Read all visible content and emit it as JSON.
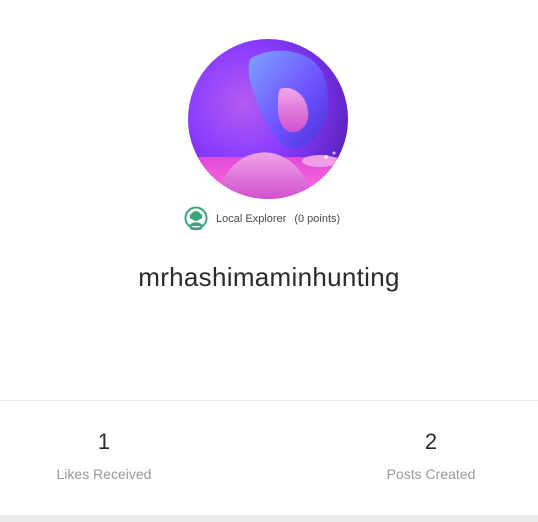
{
  "profile": {
    "username": "mrhashimaminhunting",
    "badge": {
      "icon": "explorer-badge-icon",
      "title": "Local Explorer",
      "points": "(0 points)"
    }
  },
  "stats": {
    "likes": {
      "value": "1",
      "label": "Likes Received"
    },
    "posts": {
      "value": "2",
      "label": "Posts Created"
    }
  },
  "colors": {
    "badge_green": "#3aa57a",
    "avatar_purple": "#8a3cff",
    "avatar_magenta": "#e24ad8"
  }
}
